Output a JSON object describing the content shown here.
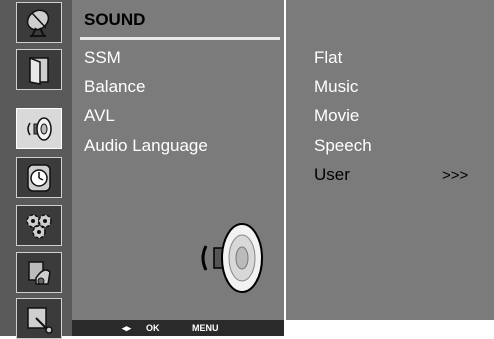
{
  "menu": {
    "title": "SOUND",
    "items": [
      {
        "label": "SSM"
      },
      {
        "label": "Balance"
      },
      {
        "label": "AVL"
      },
      {
        "label": "Audio Language"
      }
    ]
  },
  "submenu": {
    "items": [
      {
        "label": "Flat"
      },
      {
        "label": "Music"
      },
      {
        "label": "Movie"
      },
      {
        "label": "Speech"
      },
      {
        "label": "User"
      }
    ],
    "selected": "User",
    "more_indicator": ">>>"
  },
  "sidebar": {
    "icons": [
      "satellite-dish-icon",
      "door-icon",
      "speaker-icon",
      "clock-icon",
      "gears-icon",
      "parental-lock-icon",
      "screen-icon"
    ],
    "active_icon": "speaker-icon"
  },
  "footer": {
    "move_label": "◂▸",
    "ok_label": "OK",
    "menu_label": "MENU"
  },
  "colors": {
    "panel": "#7b7b7b",
    "sidebar": "#5a5a5a",
    "footer": "#2a2a2a"
  }
}
